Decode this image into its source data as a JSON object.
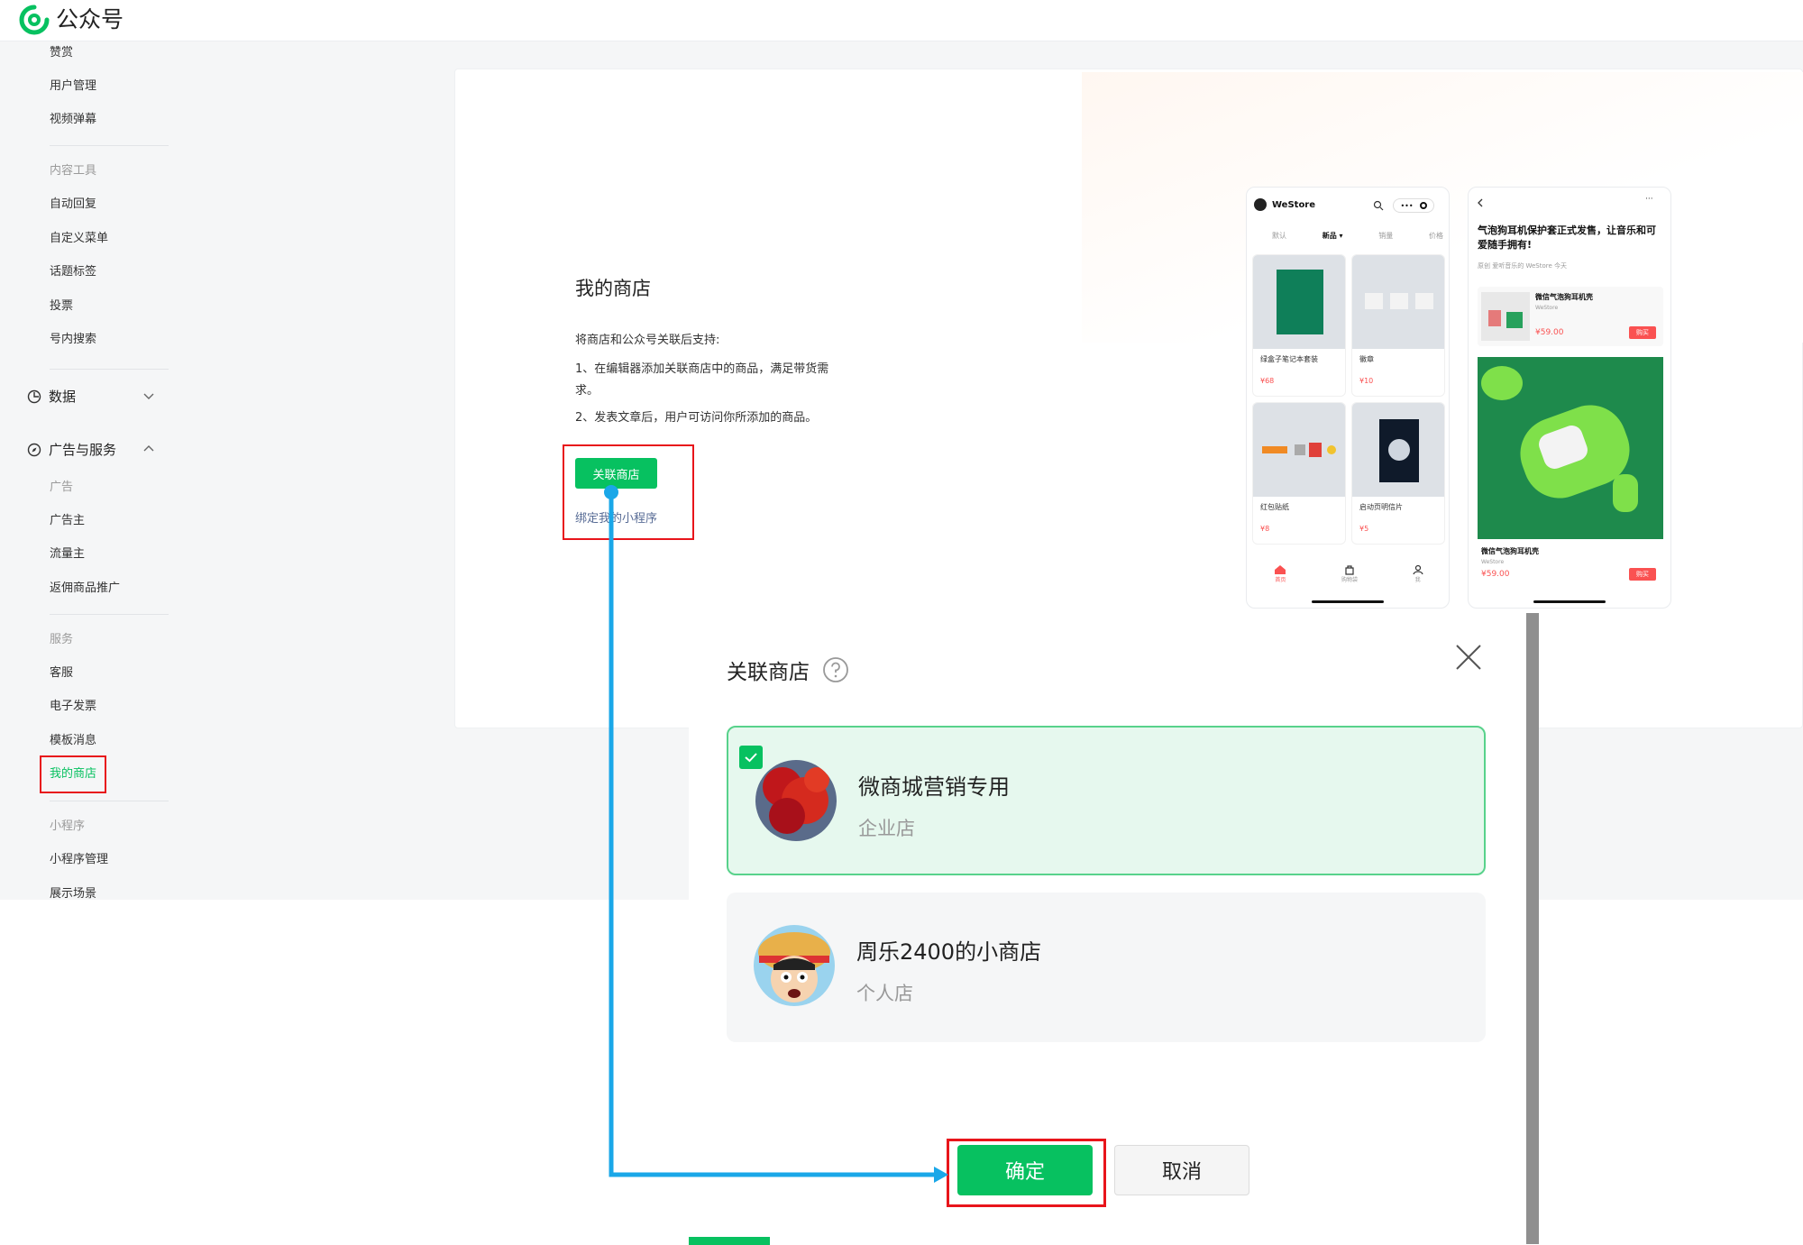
{
  "header": {
    "brand": "公众号"
  },
  "sidebar": {
    "items_top": [
      "赞赏",
      "用户管理",
      "视频弹幕"
    ],
    "cat_content": "内容工具",
    "items_content": [
      "自动回复",
      "自定义菜单",
      "话题标签",
      "投票",
      "号内搜索"
    ],
    "group_data": "数据",
    "group_ads": "广告与服务",
    "cat_ads": "广告",
    "items_ads": [
      "广告主",
      "流量主",
      "返佣商品推广"
    ],
    "cat_service": "服务",
    "items_service": [
      "客服",
      "电子发票",
      "模板消息",
      "我的商店"
    ],
    "cat_mini": "小程序",
    "items_mini": [
      "小程序管理",
      "展示场景"
    ]
  },
  "shop": {
    "title": "我的商店",
    "desc_intro": "将商店和公众号关联后支持:",
    "desc_1": "1、在编辑器添加关联商店中的商品，满足带货需求。",
    "desc_2": "2、发表文章后，用户可访问你所添加的商品。",
    "link_button": "关联商店",
    "bind_link": "绑定我的小程序"
  },
  "preview1": {
    "store": "WeStore",
    "tabs": [
      "默认",
      "新品 ▾",
      "销量",
      "价格"
    ],
    "products": [
      {
        "name": "绿盒子笔记本套装",
        "price": "¥68"
      },
      {
        "name": "徽章",
        "price": "¥10"
      },
      {
        "name": "红包贴纸",
        "price": "¥8"
      },
      {
        "name": "启动页明信片",
        "price": "¥5"
      }
    ],
    "nav": [
      "首页",
      "购物袋",
      "我"
    ]
  },
  "preview2": {
    "title": "气泡狗耳机保护套正式发售，让音乐和可爱随手拥有!",
    "meta": "原创 爱听音乐的 WeStore 今天",
    "product_name": "微信气泡狗耳机壳",
    "product_sub": "WeStore",
    "price": "¥59.00",
    "buy": "购买"
  },
  "dialog": {
    "title": "关联商店",
    "options": [
      {
        "name": "微商城营销专用",
        "type": "企业店"
      },
      {
        "name": "周乐2400的小商店",
        "type": "个人店"
      }
    ],
    "ok": "确定",
    "cancel": "取消"
  },
  "colors": {
    "accent": "#07c160",
    "highlight": "#e8151b",
    "arrow": "#1aa7e8"
  }
}
